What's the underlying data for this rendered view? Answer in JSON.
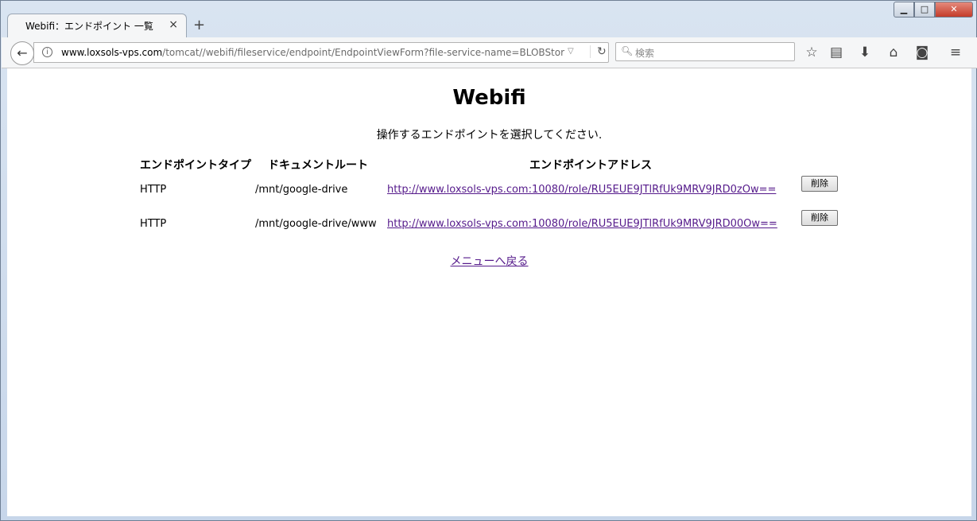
{
  "browser": {
    "tab_title": "Webifi：エンドポイント 一覧",
    "tab_close": "×",
    "new_tab": "+",
    "url_host": "www.loxsols-vps.com",
    "url_path": "/tomcat//webifi/fileservice/endpoint/EndpointViewForm?file-service-name=BLOBStor",
    "search_placeholder": "検索",
    "window_controls": {
      "minimize": "▁",
      "maximize": "□",
      "close": "✕"
    }
  },
  "page": {
    "title": "Webifi",
    "instruction": "操作するエンドポイントを選択してください.",
    "headers": {
      "type": "エンドポイントタイプ",
      "docroot": "ドキュメントルート",
      "address": "エンドポイントアドレス"
    },
    "rows": [
      {
        "type": "HTTP",
        "docroot": "/mnt/google-drive",
        "address": "http://www.loxsols-vps.com:10080/role/RU5EUE9JTlRfUk9MRV9JRD0zOw==",
        "delete_label": "削除"
      },
      {
        "type": "HTTP",
        "docroot": "/mnt/google-drive/www",
        "address": "http://www.loxsols-vps.com:10080/role/RU5EUE9JTlRfUk9MRV9JRD00Ow==",
        "delete_label": "削除"
      }
    ],
    "back_to_menu": "メニューへ戻る"
  },
  "colors": {
    "visited_link": "#551a8b",
    "chrome_bg": "#c7d6ea",
    "close_red": "#c43c2a"
  },
  "icons": [
    "back-arrow-icon",
    "info-icon",
    "dropdown-icon",
    "reload-icon",
    "search-icon",
    "star-icon",
    "reading-list-icon",
    "download-icon",
    "home-icon",
    "pocket-icon",
    "menu-icon"
  ]
}
